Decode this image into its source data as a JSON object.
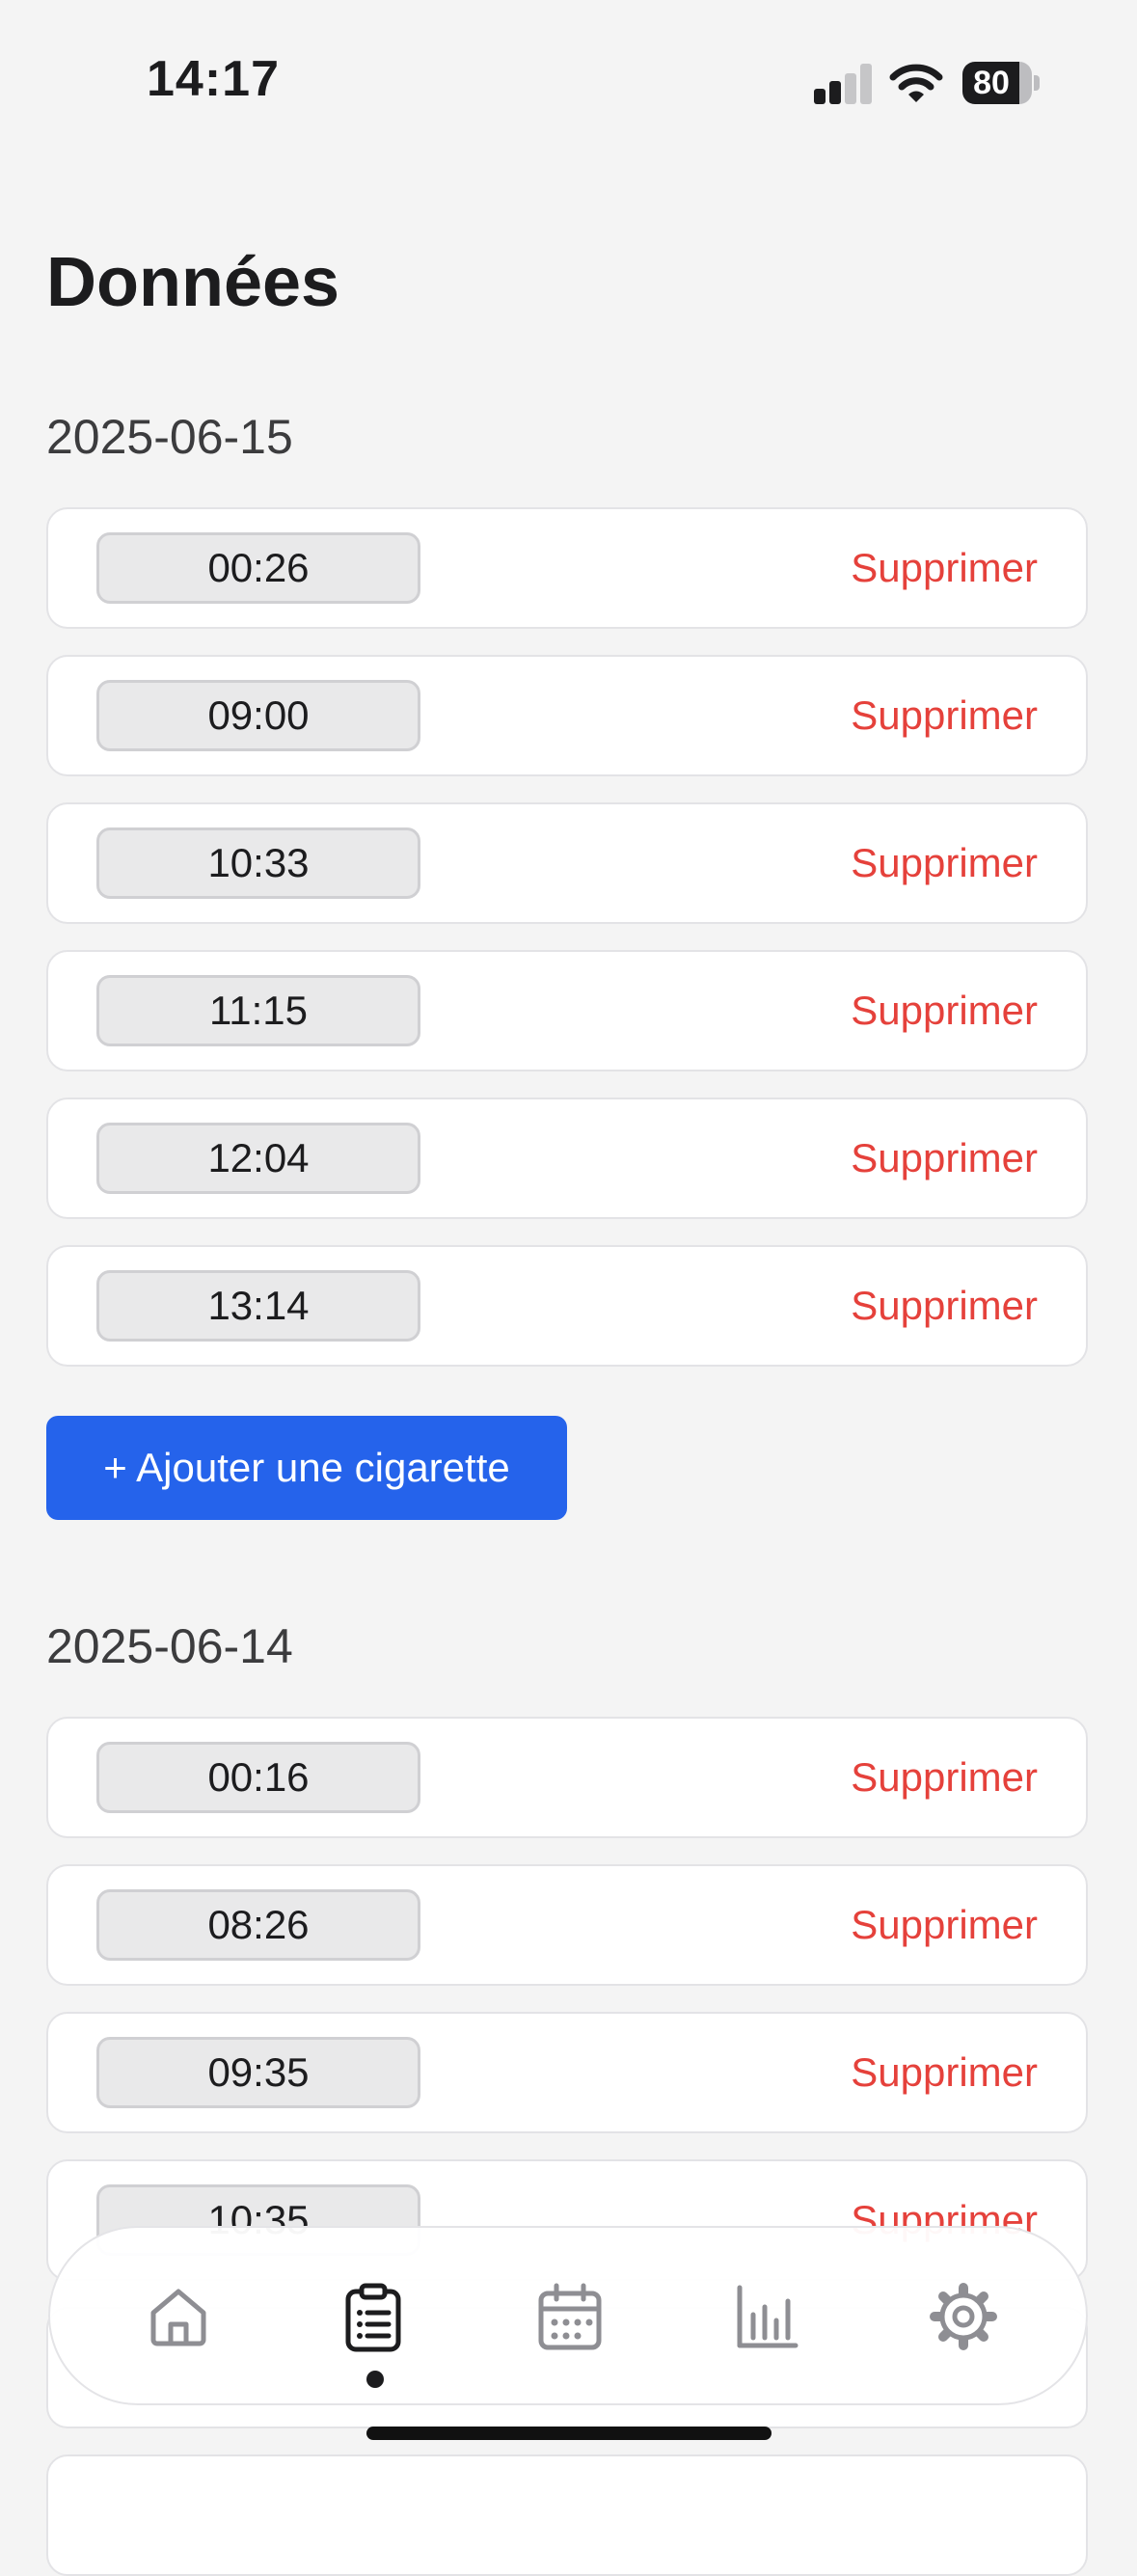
{
  "status_bar": {
    "time": "14:17",
    "battery": "80"
  },
  "page": {
    "title": "Données"
  },
  "days": [
    {
      "date": "2025-06-15",
      "entries": [
        {
          "time": "00:26",
          "delete_label": "Supprimer"
        },
        {
          "time": "09:00",
          "delete_label": "Supprimer"
        },
        {
          "time": "10:33",
          "delete_label": "Supprimer"
        },
        {
          "time": "11:15",
          "delete_label": "Supprimer"
        },
        {
          "time": "12:04",
          "delete_label": "Supprimer"
        },
        {
          "time": "13:14",
          "delete_label": "Supprimer"
        }
      ],
      "add_label": "+ Ajouter une cigarette"
    },
    {
      "date": "2025-06-14",
      "entries": [
        {
          "time": "00:16",
          "delete_label": "Supprimer"
        },
        {
          "time": "08:26",
          "delete_label": "Supprimer"
        },
        {
          "time": "09:35",
          "delete_label": "Supprimer"
        },
        {
          "time": "10:35",
          "delete_label": "Supprimer"
        }
      ]
    }
  ],
  "tab_bar": {
    "tabs": [
      {
        "icon": "home-icon",
        "active": false
      },
      {
        "icon": "clipboard-list-icon",
        "active": true
      },
      {
        "icon": "calendar-icon",
        "active": false
      },
      {
        "icon": "bar-chart-icon",
        "active": false
      },
      {
        "icon": "gear-icon",
        "active": false
      }
    ]
  },
  "colors": {
    "accent": "#2563eb",
    "danger": "#e5413b",
    "background": "#f4f4f4"
  }
}
